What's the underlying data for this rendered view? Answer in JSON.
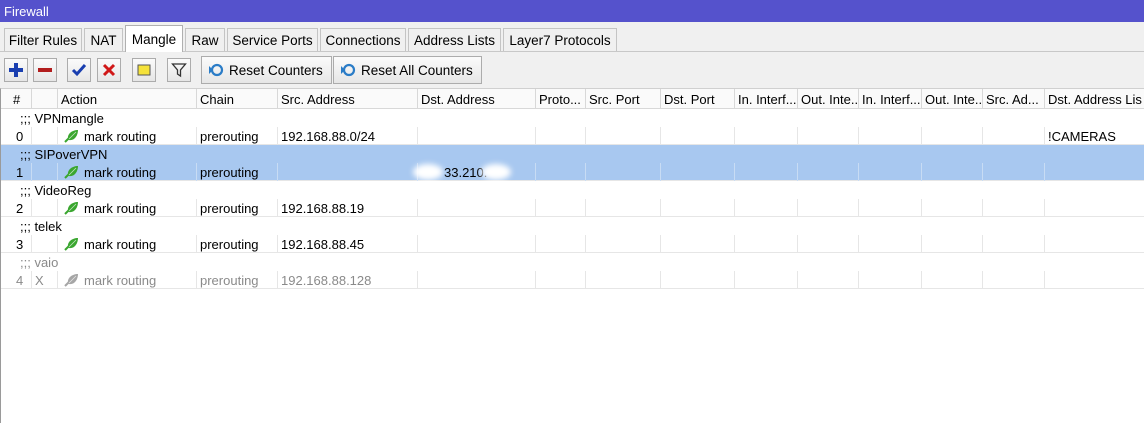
{
  "window": {
    "title": "Firewall"
  },
  "tabs": [
    {
      "label": "Filter Rules",
      "active": false
    },
    {
      "label": "NAT",
      "active": false
    },
    {
      "label": "Mangle",
      "active": true
    },
    {
      "label": "Raw",
      "active": false
    },
    {
      "label": "Service Ports",
      "active": false
    },
    {
      "label": "Connections",
      "active": false
    },
    {
      "label": "Address Lists",
      "active": false
    },
    {
      "label": "Layer7 Protocols",
      "active": false
    }
  ],
  "toolbar": {
    "add_icon": "plus-icon",
    "remove_icon": "minus-icon",
    "enable_icon": "check-icon",
    "disable_icon": "x-icon",
    "comment_icon": "note-icon",
    "filter_icon": "funnel-icon",
    "reset_counters_label": "Reset Counters",
    "reset_all_counters_label": "Reset All Counters"
  },
  "columns": [
    "#",
    "",
    "Action",
    "Chain",
    "Src. Address",
    "Dst. Address",
    "Proto...",
    "Src. Port",
    "Dst. Port",
    "In. Interf...",
    "Out. Inte...",
    "In. Interf...",
    "Out. Inte...",
    "Src. Ad...",
    "Dst. Address Lis"
  ],
  "rules": [
    {
      "comment": ";;; VPNmangle",
      "num": "0",
      "flag": "",
      "action": "mark routing",
      "chain": "prerouting",
      "src": "192.168.88.0/24",
      "dst": "",
      "dst_list": "!CAMERAS",
      "selected": false,
      "disabled": false
    },
    {
      "comment": ";;; SIPoverVPN",
      "num": "1",
      "flag": "",
      "action": "mark routing",
      "chain": "prerouting",
      "src": "",
      "dst": "33.210.",
      "dst_list": "",
      "selected": true,
      "disabled": false
    },
    {
      "comment": ";;; VideoReg",
      "num": "2",
      "flag": "",
      "action": "mark routing",
      "chain": "prerouting",
      "src": "192.168.88.19",
      "dst": "",
      "dst_list": "",
      "selected": false,
      "disabled": false
    },
    {
      "comment": ";;; telek",
      "num": "3",
      "flag": "",
      "action": "mark routing",
      "chain": "prerouting",
      "src": "192.168.88.45",
      "dst": "",
      "dst_list": "",
      "selected": false,
      "disabled": false
    },
    {
      "comment": ";;; vaio",
      "num": "4",
      "flag": "X",
      "action": "mark routing",
      "chain": "prerouting",
      "src": "192.168.88.128",
      "dst": "",
      "dst_list": "",
      "selected": false,
      "disabled": true
    }
  ],
  "colors": {
    "titlebar": "#5552cc",
    "selection": "#a8c8f0",
    "leaf_green": "#3aa62f",
    "leaf_disabled": "#a6a6a6",
    "add_blue": "#1a3fb0",
    "remove_red": "#b21d1d"
  }
}
